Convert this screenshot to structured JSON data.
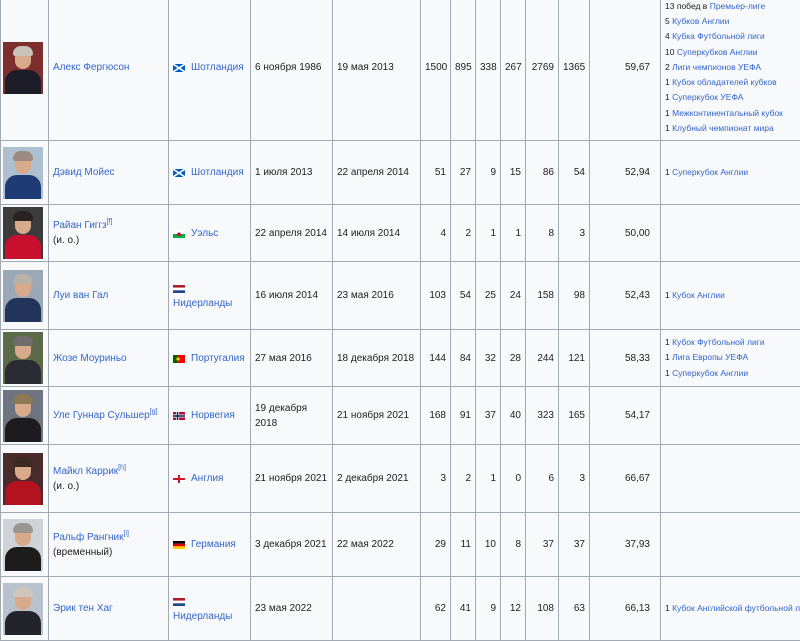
{
  "rows": [
    {
      "name": "Алекс Фергюсон",
      "note_sup": "",
      "sub": "",
      "country": "Шотландия",
      "flag": "scotland",
      "start": "6 ноября 1986",
      "end": "19 мая 2013",
      "p": "1500",
      "w": "895",
      "d": "338",
      "l": "267",
      "gf": "2769",
      "ga": "1365",
      "pct": "59,67",
      "photo": {
        "bg": "#7c2f2c",
        "body": "#1d1d2a",
        "hair": "#c9c3bb"
      },
      "trophies": [
        {
          "n": "13",
          "t": "побед в",
          "l": "Премьер-лиге"
        },
        {
          "n": "5",
          "t": "",
          "l": "Кубков Англии"
        },
        {
          "n": "4",
          "t": "",
          "l": "Кубка Футбольной лиги"
        },
        {
          "n": "10",
          "t": "",
          "l": "Суперкубков Англии"
        },
        {
          "n": "2",
          "t": "",
          "l": "Лиги чемпионов УЕФА"
        },
        {
          "n": "1",
          "t": "",
          "l": "Кубок обладателей кубков"
        },
        {
          "n": "1",
          "t": "",
          "l": "Суперкубок УЕФА"
        },
        {
          "n": "1",
          "t": "",
          "l": "Межконтинентальный кубок"
        },
        {
          "n": "1",
          "t": "",
          "l": "Клубный чемпионат мира"
        }
      ]
    },
    {
      "name": "Дэвид Мойес",
      "note_sup": "",
      "sub": "",
      "country": "Шотландия",
      "flag": "scotland",
      "start": "1 июля 2013",
      "end": "22 апреля 2014",
      "p": "51",
      "w": "27",
      "d": "9",
      "l": "15",
      "gf": "86",
      "ga": "54",
      "pct": "52,94",
      "photo": {
        "bg": "#aebfd0",
        "body": "#1f3b75",
        "hair": "#9a8a80"
      },
      "trophies": [
        {
          "n": "1",
          "t": "",
          "l": "Суперкубок Англии"
        }
      ]
    },
    {
      "name": "Райан Гиггз",
      "note_sup": "[f]",
      "sub": "(и. о.)",
      "country": "Уэльс",
      "flag": "wales",
      "start": "22 апреля 2014",
      "end": "14 июля 2014",
      "p": "4",
      "w": "2",
      "d": "1",
      "l": "1",
      "gf": "8",
      "ga": "3",
      "pct": "50,00",
      "photo": {
        "bg": "#3c3c3c",
        "body": "#c8102e",
        "hair": "#2a2220"
      },
      "trophies": []
    },
    {
      "name": "Луи ван Гал",
      "note_sup": "",
      "sub": "",
      "country": "Нидерланды",
      "flag": "netherlands",
      "start": "16 июля 2014",
      "end": "23 мая 2016",
      "p": "103",
      "w": "54",
      "d": "25",
      "l": "24",
      "gf": "158",
      "ga": "98",
      "pct": "52,43",
      "photo": {
        "bg": "#9aa8b6",
        "body": "#22345a",
        "hair": "#b9b0a8"
      },
      "trophies": [
        {
          "n": "1",
          "t": "",
          "l": "Кубок Англии"
        }
      ]
    },
    {
      "name": "Жозе Моуриньо",
      "note_sup": "",
      "sub": "",
      "country": "Португалия",
      "flag": "portugal",
      "start": "27 мая 2016",
      "end": "18 декабря 2018",
      "p": "144",
      "w": "84",
      "d": "32",
      "l": "28",
      "gf": "244",
      "ga": "121",
      "pct": "58,33",
      "photo": {
        "bg": "#5b6b4a",
        "body": "#2b2b33",
        "hair": "#6f6c6a"
      },
      "trophies": [
        {
          "n": "1",
          "t": "",
          "l": "Кубок Футбольной лиги"
        },
        {
          "n": "1",
          "t": "",
          "l": "Лига Европы УЕФА"
        },
        {
          "n": "1",
          "t": "",
          "l": "Суперкубок Англии"
        }
      ]
    },
    {
      "name": "Уле Гуннар Сульшер",
      "note_sup": "[g]",
      "sub": "",
      "country": "Норвегия",
      "flag": "norway",
      "start": "19 декабря 2018",
      "end": "21 ноября 2021",
      "p": "168",
      "w": "91",
      "d": "37",
      "l": "40",
      "gf": "323",
      "ga": "165",
      "pct": "54,17",
      "photo": {
        "bg": "#6e7480",
        "body": "#1b1b20",
        "hair": "#8d7a55"
      },
      "trophies": []
    },
    {
      "name": "Майкл Каррик",
      "note_sup": "[h]",
      "sub": "(и. о.)",
      "country": "Англия",
      "flag": "england",
      "start": "21 ноября 2021",
      "end": "2 декабря 2021",
      "p": "3",
      "w": "2",
      "d": "1",
      "l": "0",
      "gf": "6",
      "ga": "3",
      "pct": "66,67",
      "photo": {
        "bg": "#4a2b2b",
        "body": "#b3121f",
        "hair": "#3a2a20"
      },
      "trophies": []
    },
    {
      "name": "Ральф Рангник",
      "note_sup": "[i]",
      "sub": "(временный)",
      "country": "Германия",
      "flag": "germany",
      "start": "3 декабря 2021",
      "end": "22 мая 2022",
      "p": "29",
      "w": "11",
      "d": "10",
      "l": "8",
      "gf": "37",
      "ga": "37",
      "pct": "37,93",
      "photo": {
        "bg": "#cfd2d6",
        "body": "#1c1c1c",
        "hair": "#9b9590"
      },
      "trophies": []
    },
    {
      "name": "Эрик тен Хаг",
      "note_sup": "",
      "sub": "",
      "country": "Нидерланды",
      "flag": "netherlands",
      "start": "23 мая 2022",
      "end": "",
      "p": "62",
      "w": "41",
      "d": "9",
      "l": "12",
      "gf": "108",
      "ga": "63",
      "pct": "66,13",
      "photo": {
        "bg": "#b8c2cc",
        "body": "#23232b",
        "hair": "#cfc6bd"
      },
      "trophies": [
        {
          "n": "1",
          "t": "",
          "l": "Кубок Английской футбольной лиги"
        }
      ]
    }
  ]
}
